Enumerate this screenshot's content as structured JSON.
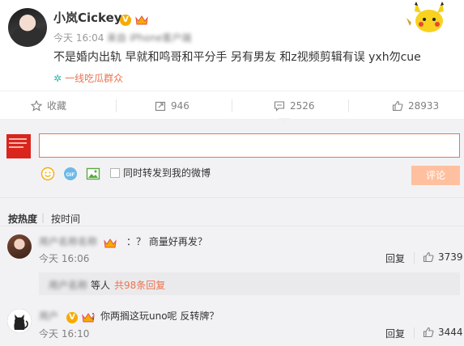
{
  "post": {
    "username": "小岚Cickey",
    "vbadge": "V",
    "time": "今天 16:04",
    "source": "来自 iPhone客户端",
    "text": "不是婚内出轨 早就和鸣哥和平分手 另有男友 和z视频剪辑有误  yxh勿cue",
    "group_icon": "✲",
    "group": "一线吃瓜群众"
  },
  "actions": {
    "favorite": "收藏",
    "forward": "946",
    "comment": "2526",
    "like": "28933"
  },
  "composer": {
    "input_value": "",
    "forward_label": "同时转发到我的微博",
    "submit_label": "评论",
    "gif_label": "GIF"
  },
  "sort": {
    "hot": "按热度",
    "separator": "|",
    "time": "按时间"
  },
  "comments": [
    {
      "name": "用户名称名称",
      "text": "：？ 商量好再发？",
      "time": "今天 16:06",
      "reply": "回复",
      "likes": "3739",
      "more_users": "用户名称",
      "more_text": "等人",
      "more_count": "共98条回复"
    },
    {
      "name": "用户",
      "vbadge": "V",
      "text": "：你两搁这玩uno呢 反转牌？",
      "time": "今天 16:10",
      "reply": "回复",
      "likes": "3444"
    }
  ],
  "colors": {
    "accent": "#eb7350",
    "verified": "#f7ab00",
    "submit_disabled": "#ffc09f",
    "panel_bg": "#f2f2f5"
  }
}
